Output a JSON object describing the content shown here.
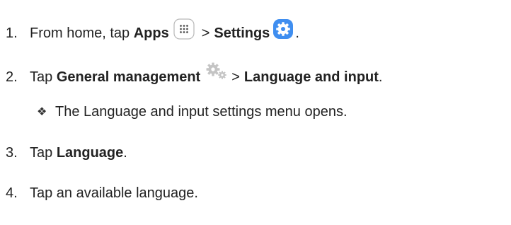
{
  "steps": [
    {
      "number": "1.",
      "text_a": "From home, tap ",
      "bold_a": "Apps",
      "separator": ">",
      "bold_b": "Settings",
      "text_end": "."
    },
    {
      "number": "2.",
      "text_a": "Tap ",
      "bold_a": "General management",
      "separator": ">",
      "bold_b": "Language and input",
      "text_end": "."
    },
    {
      "number": "3.",
      "text_a": "Tap ",
      "bold_a": "Language",
      "text_end": "."
    },
    {
      "number": "4.",
      "text_a": "Tap an available language."
    }
  ],
  "bullet": {
    "mark": "❖",
    "text": "The Language and input settings menu opens."
  },
  "icons": {
    "apps": "apps-grid-icon",
    "settings": "settings-gear-icon",
    "general_management": "general-management-gears-icon"
  },
  "colors": {
    "text": "#222222",
    "settings_blue": "#3f8ef0",
    "gear_gray": "#c4c4c4"
  }
}
